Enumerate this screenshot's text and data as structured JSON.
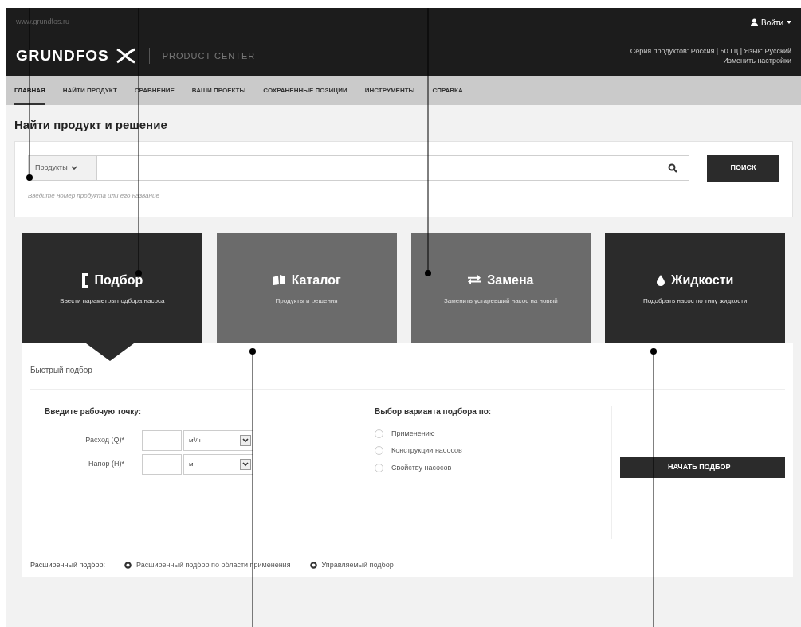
{
  "header": {
    "site_address": "www.grundfos.ru",
    "login": "Войти",
    "logo": "GRUNDFOS",
    "product_center": "PRODUCT CENTER",
    "settings_line": "Серия продуктов: Россия | 50 Гц | Язык: Русский",
    "settings_link": "Изменить настройки"
  },
  "nav": [
    {
      "label": "ГЛАВНАЯ",
      "selected": true
    },
    {
      "label": "НАЙТИ ПРОДУКТ",
      "selected": false
    },
    {
      "label": "СРАВНЕНИЕ",
      "selected": false
    },
    {
      "label": "ВАШИ ПРОЕКТЫ",
      "selected": false
    },
    {
      "label": "СОХРАНЁННЫЕ ПОЗИЦИИ",
      "selected": false
    },
    {
      "label": "ИНСТРУМЕНТЫ",
      "selected": false
    },
    {
      "label": "СПРАВКА",
      "selected": false
    }
  ],
  "search": {
    "title": "Найти продукт и решение",
    "category": "Продукты",
    "button": "ПОИСК",
    "hint": "Введите номер продукта или его название"
  },
  "tiles": [
    {
      "kind": "ruler",
      "title": "Подбор",
      "subtitle": "Ввести параметры подбора насоса",
      "selected": true,
      "color": "#2b2b2b"
    },
    {
      "kind": "book",
      "title": "Каталог",
      "subtitle": "Продукты и решения",
      "selected": false,
      "color": "#6b6b6b"
    },
    {
      "kind": "swap",
      "title": "Замена",
      "subtitle": "Заменить устаревший насос на новый",
      "selected": false,
      "color": "#6b6b6b"
    },
    {
      "kind": "drop",
      "title": "Жидкости",
      "subtitle": "Подобрать насос по типу жидкости",
      "selected": false,
      "color": "#2b2b2b"
    }
  ],
  "quick": {
    "title": "Быстрый подбор",
    "point_title": "Введите рабочую точку:",
    "fields": [
      {
        "label": "Расход (Q)*",
        "unit": "м³/ч"
      },
      {
        "label": "Напор (H)*",
        "unit": "м"
      }
    ],
    "option_title": "Выбор варианта подбора по:",
    "options": [
      {
        "label": "Применению",
        "selected": false
      },
      {
        "label": "Конструкции насосов",
        "selected": false
      },
      {
        "label": "Свойству насосов",
        "selected": false
      }
    ],
    "start_button": "НАЧАТЬ ПОДБОР"
  },
  "advanced": {
    "label": "Расширенный подбор:",
    "links": [
      "Расширенный подбор по области применения",
      "Управляемый подбор"
    ]
  }
}
